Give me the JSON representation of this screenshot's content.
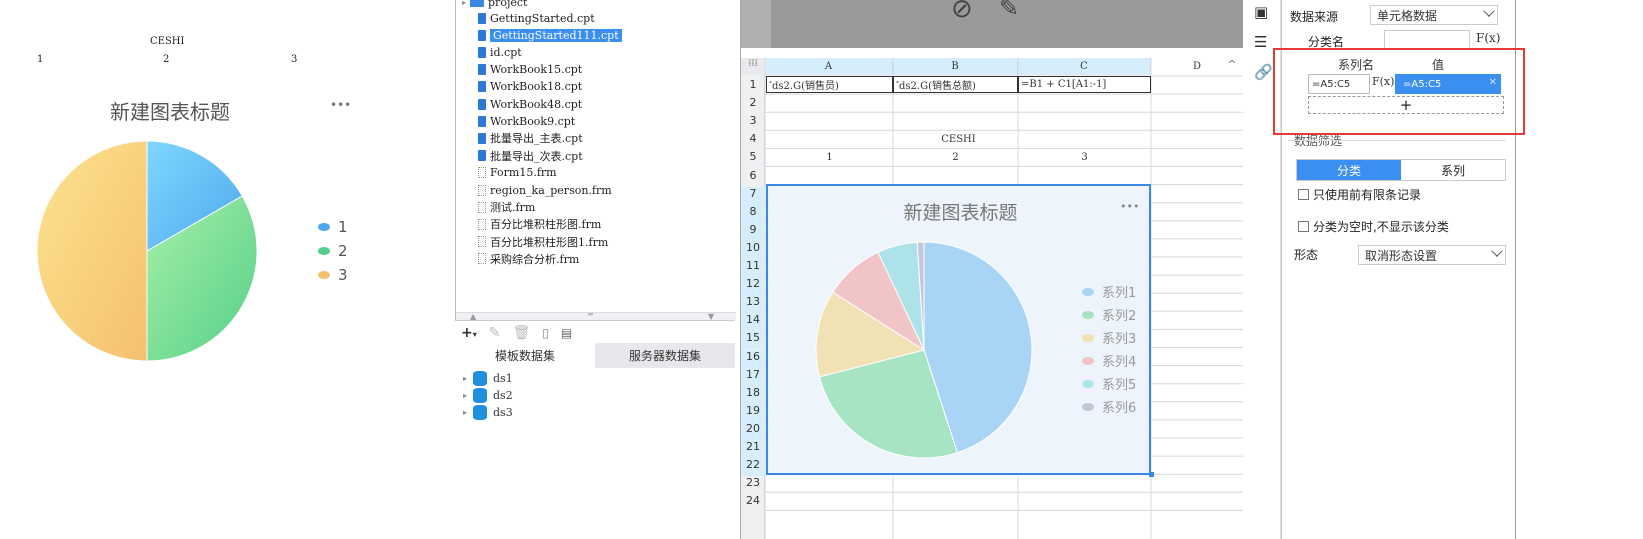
{
  "preview": {
    "header": "CESHI",
    "values": [
      "1",
      "2",
      "3"
    ],
    "chart_title": "新建图表标题",
    "more": "•••",
    "legend": [
      "1",
      "2",
      "3"
    ]
  },
  "chart_data": [
    {
      "type": "pie",
      "title": "新建图表标题",
      "categories": [
        "1",
        "2",
        "3"
      ],
      "values": [
        1,
        2,
        3
      ],
      "colors": [
        "#5fc0f5",
        "#7ee08f",
        "#f8cf7a"
      ],
      "legend": "right"
    },
    {
      "type": "pie",
      "title": "新建图表标题",
      "categories": [
        "系列1",
        "系列2",
        "系列3",
        "系列4",
        "系列5",
        "系列6"
      ],
      "values": [
        45,
        26,
        13,
        9,
        6,
        1
      ],
      "colors": [
        "#a8d4f5",
        "#a6e4c4",
        "#f1e2b6",
        "#f1c4c8",
        "#ade2e8",
        "#c6c6d8"
      ],
      "legend": "right"
    }
  ],
  "tree": {
    "root": "project",
    "files": [
      "GettingStarted.cpt",
      "GettingStarted111.cpt",
      "id.cpt",
      "WorkBook15.cpt",
      "WorkBook18.cpt",
      "WorkBook48.cpt",
      "WorkBook9.cpt",
      "批量导出_主表.cpt",
      "批量导出_次表.cpt",
      "Form15.frm",
      "region_ka_person.frm",
      "测试.frm",
      "百分比堆积柱形图.frm",
      "百分比堆积柱形图1.frm",
      "采购综合分析.frm"
    ],
    "selected_index": 1
  },
  "datasets": {
    "tabs": [
      "模板数据集",
      "服务器数据集"
    ],
    "items": [
      "ds1",
      "ds2",
      "ds3"
    ]
  },
  "sheet": {
    "columns": [
      "A",
      "B",
      "C",
      "D"
    ],
    "rows": [
      "1",
      "2",
      "3",
      "4",
      "5",
      "6",
      "7",
      "8",
      "9",
      "10",
      "11",
      "12",
      "13",
      "14",
      "15",
      "16",
      "17",
      "18",
      "19",
      "20",
      "21",
      "22",
      "23",
      "24"
    ],
    "a1": "ds2.G(销售员)",
    "b1": "ds2.G(销售总额)",
    "c1": "=B1 + C1[A1:-1]",
    "ceshi": "CESHI",
    "row5": [
      "1",
      "2",
      "3"
    ],
    "chart_title": "新建图表标题",
    "more": "•••",
    "legend": [
      "系列1",
      "系列2",
      "系列3",
      "系列4",
      "系列5",
      "系列6"
    ]
  },
  "panel": {
    "data_source_label": "数据来源",
    "data_source_value": "单元格数据",
    "category_label": "分类名",
    "fx": "F(x)",
    "series_name_header": "系列名",
    "value_header": "值",
    "series_name_value": "=A5:C5",
    "value_value": "=A5:C5",
    "add": "+",
    "filter_label": "数据筛选",
    "tab_category": "分类",
    "tab_series": "系列",
    "check1": "只使用前有限条记录",
    "check2": "分类为空时,不显示该分类",
    "form_label": "形态",
    "form_value": "取消形态设置"
  }
}
